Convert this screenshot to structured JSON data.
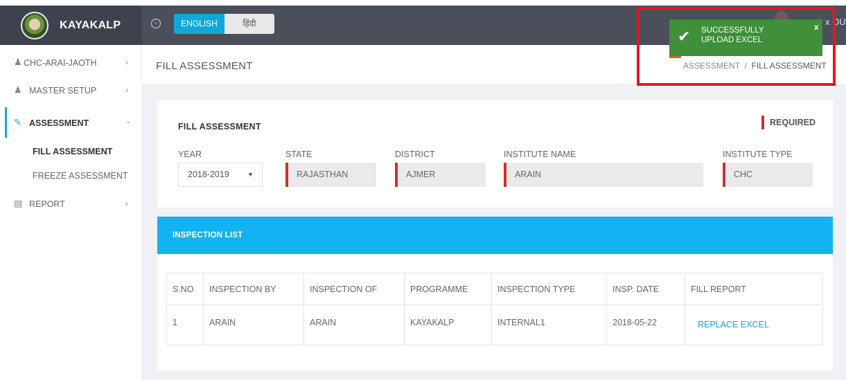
{
  "app": {
    "brand": "KAYAKALP",
    "lang_english": "ENGLISH",
    "lang_hindi": "हिंदी",
    "logout_label": "x OUT"
  },
  "toast": {
    "message": "SUCCESSFULLY UPLOAD EXCEL",
    "close": "x",
    "check_icon": "✔",
    "color": "#3f8f3b"
  },
  "sidebar": {
    "items": [
      {
        "label": "CHC-ARAI-JAOTH",
        "icon": "user-icon"
      },
      {
        "label": "MASTER SETUP",
        "icon": "user-icon"
      },
      {
        "label": "ASSESSMENT",
        "icon": "edit-icon"
      },
      {
        "label": "REPORT",
        "icon": "calendar-icon"
      }
    ],
    "sub_items": [
      "FILL ASSESSMENT",
      "FREEZE ASSESSMENT"
    ]
  },
  "header": {
    "title": "FILL ASSESSMENT",
    "breadcrumb_parent": "ASSESSMENT",
    "breadcrumb_sep": "/",
    "breadcrumb_current": "FILL ASSESSMENT"
  },
  "form": {
    "title": "FILL ASSESSMENT",
    "required_label": "REQUIRED",
    "year_label": "YEAR",
    "year_value": "2018-2019",
    "state_label": "STATE",
    "state_value": "RAJASTHAN",
    "district_label": "DISTRICT",
    "district_value": "AJMER",
    "institute_name_label": "INSTITUTE NAME",
    "institute_name_value": "ARAIN",
    "institute_type_label": "INSTITUTE TYPE",
    "institute_type_value": "CHC"
  },
  "inspection": {
    "title": "INSPECTION LIST",
    "columns": [
      "S.NO",
      "INSPECTION BY",
      "INSPECTION OF",
      "PROGRAMME",
      "INSPECTION TYPE",
      "INSP. DATE",
      "FILL REPORT"
    ],
    "rows": [
      {
        "sno": "1",
        "by": "ARAIN",
        "of": "ARAIN",
        "programme": "KAYAKALP",
        "type": "INTERNAL1",
        "date": "2018-05-22",
        "action": "REPLACE EXCEL"
      }
    ]
  },
  "colors": {
    "accent": "#11a8d9",
    "required": "#d0302c",
    "highlight": "#e8171c"
  }
}
